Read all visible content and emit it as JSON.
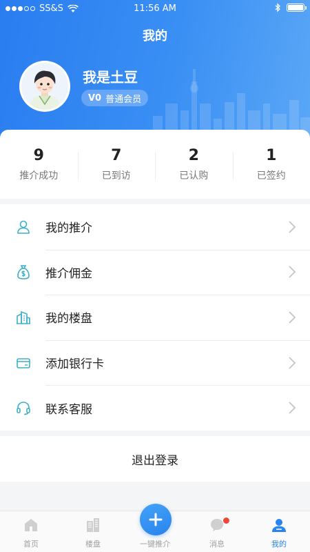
{
  "status_bar": {
    "carrier": "SS&S",
    "time": "11:56 AM",
    "signal_bars": 5,
    "signal_filled": 3
  },
  "header": {
    "title": "我的"
  },
  "profile": {
    "name": "我是土豆",
    "level": "V0",
    "member_type": "普通会员"
  },
  "stats": [
    {
      "value": "9",
      "label": "推介成功"
    },
    {
      "value": "7",
      "label": "已到访"
    },
    {
      "value": "2",
      "label": "已认购"
    },
    {
      "value": "1",
      "label": "已签约"
    }
  ],
  "menu": [
    {
      "label": "我的推介",
      "icon": "person-icon"
    },
    {
      "label": "推介佣金",
      "icon": "money-bag-icon"
    },
    {
      "label": "我的楼盘",
      "icon": "building-icon"
    },
    {
      "label": "添加银行卡",
      "icon": "card-icon"
    },
    {
      "label": "联系客服",
      "icon": "headset-icon"
    }
  ],
  "logout_label": "退出登录",
  "tabbar": {
    "items": [
      {
        "label": "首页",
        "icon": "home-icon"
      },
      {
        "label": "楼盘",
        "icon": "buildings-icon"
      },
      {
        "label": "一键推介",
        "icon": "plus-icon"
      },
      {
        "label": "消息",
        "icon": "chat-icon"
      },
      {
        "label": "我的",
        "icon": "user-icon"
      }
    ],
    "active": 4
  },
  "colors": {
    "primary": "#2a83ee",
    "accent_icon": "#3bb0c9",
    "badge": "#f0453a"
  }
}
